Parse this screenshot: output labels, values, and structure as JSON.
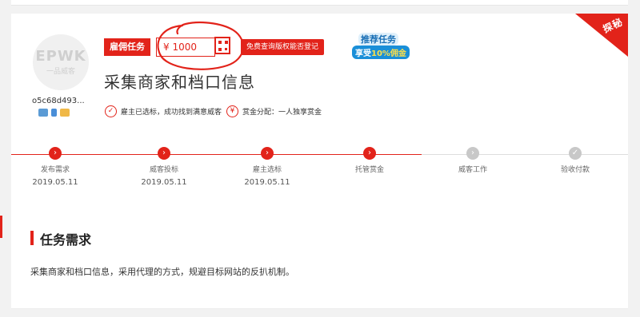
{
  "task": {
    "badge_label": "雇佣任务",
    "price": "¥ 1000",
    "check_button": "免费查询版权能否登记",
    "promo_line1": "推荐任务",
    "promo_line2_prefix": "享受",
    "promo_line2_highlight": "10%佣金",
    "title": "采集商家和档口信息",
    "corner_tag": "探秘",
    "status_selected": "雇主已选标，成功找到满意威客",
    "status_reward": "赏金分配：一人独享赏金"
  },
  "user": {
    "logo_main": "EPWK",
    "logo_sub": "一品威客",
    "name": "o5c68d493..."
  },
  "steps": [
    {
      "label": "发布需求",
      "date": "2019.05.11",
      "state": "done"
    },
    {
      "label": "威客投标",
      "date": "2019.05.11",
      "state": "done"
    },
    {
      "label": "雇主选标",
      "date": "2019.05.11",
      "state": "done"
    },
    {
      "label": "托管赏金",
      "date": "",
      "state": "done"
    },
    {
      "label": "威客工作",
      "date": "",
      "state": "todo"
    },
    {
      "label": "验收付款",
      "date": "",
      "state": "todo"
    }
  ],
  "section": {
    "title": "任务需求",
    "description": "采集商家和档口信息，采用代理的方式，规避目标网站的反扒机制。"
  },
  "colors": {
    "accent": "#e2231a",
    "pending": "#c8c8c8"
  }
}
